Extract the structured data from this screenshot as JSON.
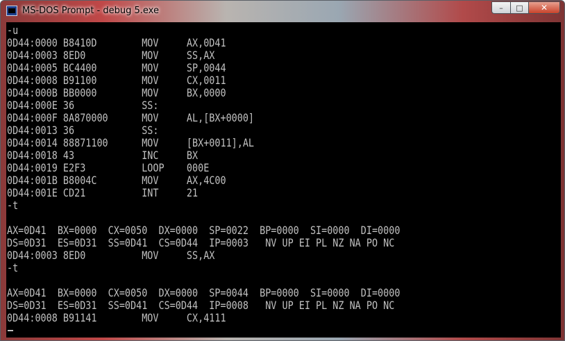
{
  "window": {
    "title": "MS-DOS Prompt - debug 5.exe",
    "buttons": {
      "minimize": "–",
      "maximize": "□",
      "close": "✕"
    }
  },
  "console": {
    "lines": [
      "-u",
      "0D44:0000 B8410D        MOV     AX,0D41",
      "0D44:0003 8ED0          MOV     SS,AX",
      "0D44:0005 BC4400        MOV     SP,0044",
      "0D44:0008 B91100        MOV     CX,0011",
      "0D44:000B BB0000        MOV     BX,0000",
      "0D44:000E 36            SS:",
      "0D44:000F 8A870000      MOV     AL,[BX+0000]",
      "0D44:0013 36            SS:",
      "0D44:0014 88871100      MOV     [BX+0011],AL",
      "0D44:0018 43            INC     BX",
      "0D44:0019 E2F3          LOOP    000E",
      "0D44:001B B8004C        MOV     AX,4C00",
      "0D44:001E CD21          INT     21",
      "-t",
      "",
      "AX=0D41  BX=0000  CX=0050  DX=0000  SP=0022  BP=0000  SI=0000  DI=0000",
      "DS=0D31  ES=0D31  SS=0D41  CS=0D44  IP=0003   NV UP EI PL NZ NA PO NC",
      "0D44:0003 8ED0          MOV     SS,AX",
      "-t",
      "",
      "AX=0D41  BX=0000  CX=0050  DX=0000  SP=0044  BP=0000  SI=0000  DI=0000",
      "DS=0D31  ES=0D31  SS=0D41  CS=0D44  IP=0008   NV UP EI PL NZ NA PO NC",
      "0D44:0008 B91141        MOV     CX,4111"
    ]
  },
  "colors": {
    "console_bg": "#000000",
    "console_fg": "#c0c0c0"
  }
}
